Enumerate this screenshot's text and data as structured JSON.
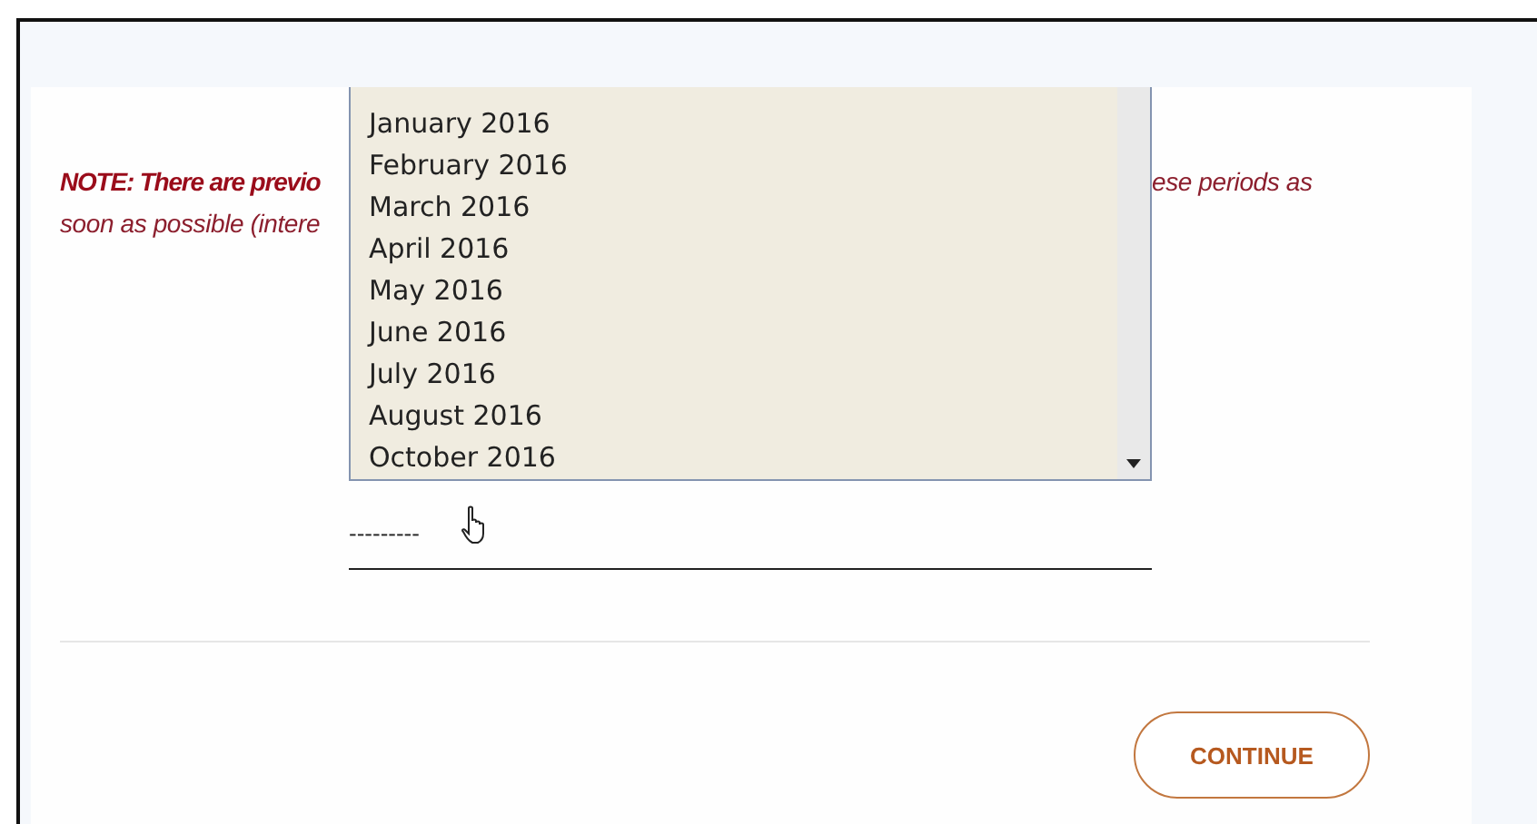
{
  "note": {
    "line1_left": "NOTE: There are previo",
    "line1_right": "ese periods as",
    "line2_left": "soon as possible (intere"
  },
  "dropdown": {
    "options": [
      {
        "label": "January 2016",
        "selected": false
      },
      {
        "label": "February 2016",
        "selected": false
      },
      {
        "label": "March 2016",
        "selected": false
      },
      {
        "label": "April 2016",
        "selected": false
      },
      {
        "label": "May 2016",
        "selected": false
      },
      {
        "label": "June 2016",
        "selected": false
      },
      {
        "label": "July 2016",
        "selected": false
      },
      {
        "label": "August 2016",
        "selected": false
      },
      {
        "label": "October 2016",
        "selected": false
      }
    ]
  },
  "select": {
    "value": "---------"
  },
  "buttons": [
    {
      "label": "CONTINUE"
    }
  ]
}
